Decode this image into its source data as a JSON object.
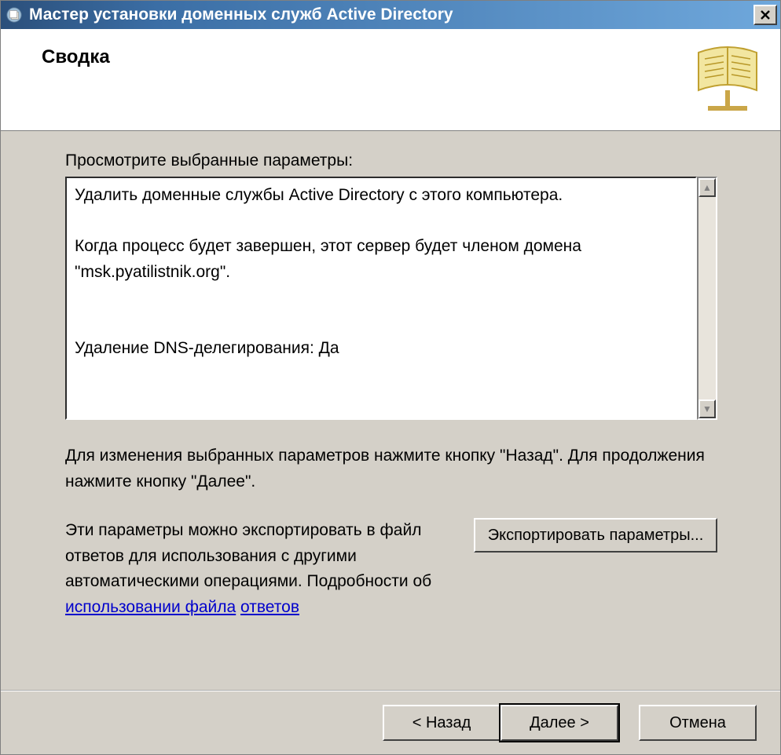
{
  "titlebar": {
    "title": "Мастер установки доменных служб Active Directory"
  },
  "header": {
    "heading": "Сводка"
  },
  "body": {
    "instruction": "Просмотрите выбранные параметры:",
    "summary_text": "Удалить доменные службы Active Directory с этого компьютера.\n\nКогда процесс будет завершен, этот сервер будет членом домена \"msk.pyatilistnik.org\".\n\n\nУдаление DNS-делегирования: Да",
    "hint": "Для изменения выбранных параметров нажмите кнопку \"Назад\". Для продолжения нажмите кнопку \"Далее\".",
    "export_text_prefix": "Эти параметры можно экспортировать в файл ответов для использования с другими автоматическими операциями. Подробности об ",
    "export_link1": "использовании файла",
    "export_link2": "ответов",
    "export_button": "Экспортировать параметры..."
  },
  "buttons": {
    "back": "< Назад",
    "next": "Далее >",
    "cancel": "Отмена"
  }
}
